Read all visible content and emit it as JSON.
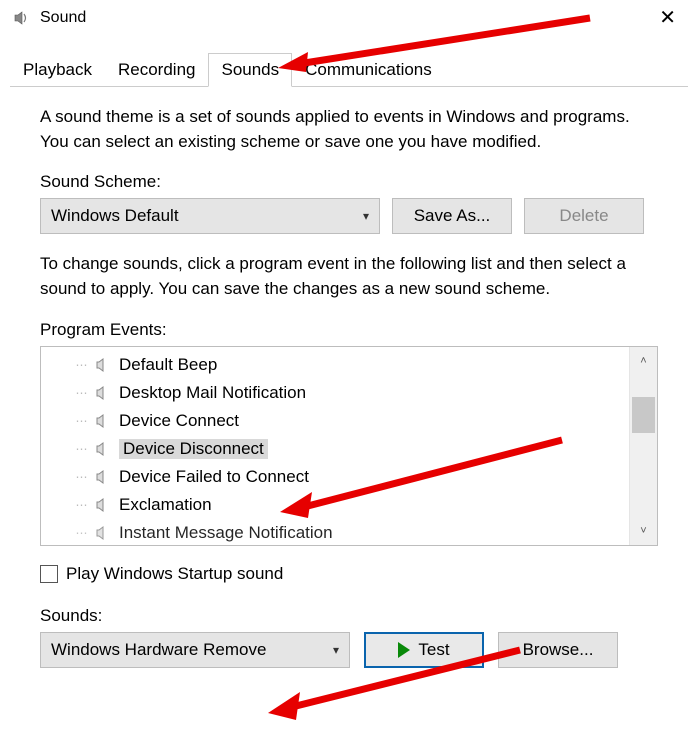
{
  "titlebar": {
    "title": "Sound"
  },
  "tabs": [
    {
      "label": "Playback",
      "active": false
    },
    {
      "label": "Recording",
      "active": false
    },
    {
      "label": "Sounds",
      "active": true
    },
    {
      "label": "Communications",
      "active": false
    }
  ],
  "description": "A sound theme is a set of sounds applied to events in Windows and programs.  You can select an existing scheme or save one you have modified.",
  "scheme": {
    "label": "Sound Scheme:",
    "value": "Windows Default",
    "save_as": "Save As...",
    "delete": "Delete"
  },
  "change_hint": "To change sounds, click a program event in the following list and then select a sound to apply.  You can save the changes as a new sound scheme.",
  "events": {
    "label": "Program Events:",
    "items": [
      {
        "label": "Default Beep",
        "selected": false
      },
      {
        "label": "Desktop Mail Notification",
        "selected": false
      },
      {
        "label": "Device Connect",
        "selected": false
      },
      {
        "label": "Device Disconnect",
        "selected": true
      },
      {
        "label": "Device Failed to Connect",
        "selected": false
      },
      {
        "label": "Exclamation",
        "selected": false
      },
      {
        "label": "Instant Message Notification",
        "selected": false
      }
    ]
  },
  "startup": {
    "label": "Play Windows Startup sound",
    "checked": false
  },
  "sounds": {
    "label": "Sounds:",
    "value": "Windows Hardware Remove",
    "test": "Test",
    "browse": "Browse..."
  }
}
